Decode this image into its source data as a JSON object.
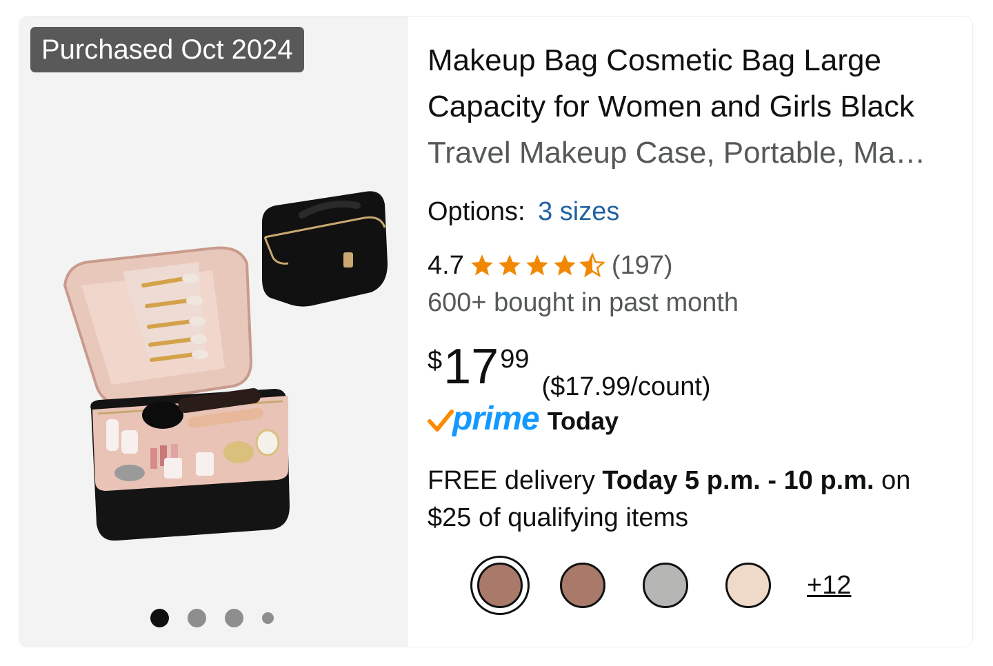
{
  "badge": {
    "text": "Purchased Oct 2024"
  },
  "product": {
    "title_line": "Makeup Bag Cosmetic Bag Large Capacity for Women and Girls Black",
    "title_continuation": "Travel Makeup Case, Portable, Ma…",
    "image_icon": "makeup-bag-photo"
  },
  "options": {
    "label": "Options:",
    "value": "3 sizes"
  },
  "rating": {
    "value": "4.7",
    "stars": 4.5,
    "review_count": "(197)",
    "star_color": "#f08804"
  },
  "bought": "600+ bought in past month",
  "price": {
    "symbol": "$",
    "whole": "17",
    "fraction": "99",
    "unit": "($17.99/count)"
  },
  "prime": {
    "word": "prime",
    "delivery_label": "Today",
    "brand_color": "#1399ff",
    "check_color": "#ff8a00"
  },
  "delivery": {
    "prefix": "FREE delivery",
    "window": "Today 5 p.m. - 10 p.m.",
    "suffix": "on $25 of qualifying items"
  },
  "carousel": {
    "count": 4,
    "active_index": 0
  },
  "swatches": {
    "colors": [
      "#a97a6a",
      "#a97a6a",
      "#b6b7b5",
      "#efd9c8"
    ],
    "selected_index": 0,
    "more_label": "+12"
  }
}
